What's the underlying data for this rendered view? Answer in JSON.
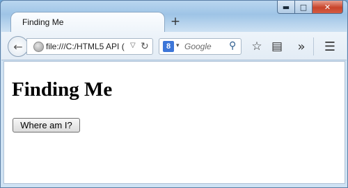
{
  "window": {
    "minimize_glyph": "▬",
    "maximize_glyph": "□",
    "close_glyph": "✕"
  },
  "tab": {
    "title": "Finding Me",
    "new_tab_glyph": "+"
  },
  "navbar": {
    "back_glyph": "←",
    "url": "file:///C:/HTML5 API (",
    "url_dropdown_glyph": "▽",
    "reload_glyph": "↻",
    "search_engine_badge": "8",
    "search_dropdown_glyph": "▾",
    "search_placeholder": "Google",
    "search_glyph": "⚲",
    "bookmark_glyph": "☆",
    "reading_list_glyph": "▤",
    "overflow_glyph": "»",
    "menu_glyph": "☰"
  },
  "page": {
    "heading": "Finding Me",
    "button_label": "Where am I?"
  }
}
